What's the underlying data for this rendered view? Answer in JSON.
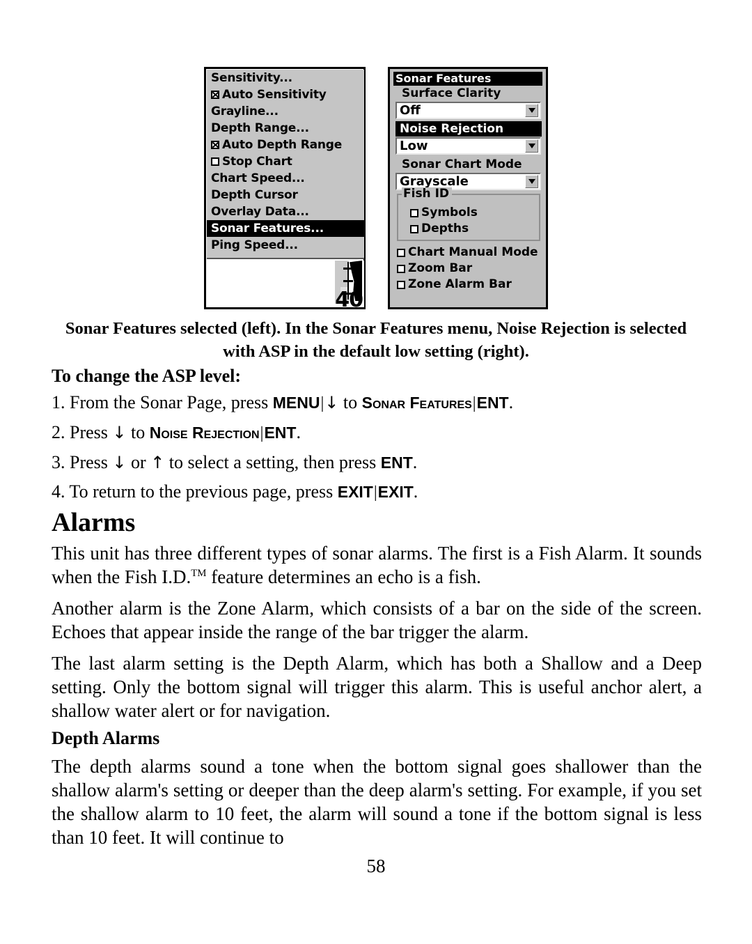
{
  "figure": {
    "left_panel": {
      "name": "sonar-main-menu",
      "menu_items": [
        {
          "label": "Sensitivity...",
          "checkbox": "none",
          "selected": false
        },
        {
          "label": "Auto Sensitivity",
          "checkbox": "checked",
          "selected": false
        },
        {
          "label": "Grayline...",
          "checkbox": "none",
          "selected": false
        },
        {
          "label": "Depth Range...",
          "checkbox": "none",
          "selected": false
        },
        {
          "label": "Auto Depth Range",
          "checkbox": "checked",
          "selected": false
        },
        {
          "label": "Stop Chart",
          "checkbox": "empty",
          "selected": false
        },
        {
          "label": "Chart Speed...",
          "checkbox": "none",
          "selected": false
        },
        {
          "label": "Depth Cursor",
          "checkbox": "none",
          "selected": false
        },
        {
          "label": "Overlay Data...",
          "checkbox": "none",
          "selected": false
        },
        {
          "label": "Sonar Features...",
          "checkbox": "none",
          "selected": true
        },
        {
          "label": "Ping Speed...",
          "checkbox": "none",
          "selected": false
        }
      ],
      "sonar_depth_reading": "40"
    },
    "right_panel": {
      "title": "Sonar Features",
      "fields": [
        {
          "label": "Surface Clarity",
          "value": "Off",
          "label_selected": false
        },
        {
          "label": "Noise Rejection",
          "value": "Low",
          "label_selected": true
        },
        {
          "label": "Sonar Chart Mode",
          "value": "Grayscale",
          "label_selected": false
        }
      ],
      "fish_id_group": {
        "legend": "Fish ID",
        "options": [
          {
            "label": "Symbols",
            "checked": false
          },
          {
            "label": "Depths",
            "checked": false
          }
        ]
      },
      "toggles": [
        {
          "label": "Chart Manual Mode",
          "checked": false
        },
        {
          "label": "Zoom Bar",
          "checked": false
        },
        {
          "label": "Zone Alarm Bar",
          "checked": false
        }
      ]
    }
  },
  "caption": "Sonar Features selected (left). In the Sonar Features menu, Noise Rejection is selected with ASP in the default low setting (right).",
  "headings": {
    "asp": "To change the ASP level:",
    "alarms": "Alarms",
    "depth_alarms": "Depth Alarms"
  },
  "steps": {
    "step1": {
      "number": "1.",
      "text_a": "From the Sonar Page, press",
      "key1": "MENU",
      "arrow1": "↓",
      "text_b": "to",
      "target": "Sonar Features",
      "key2": "ENT",
      "period": "."
    },
    "step2": {
      "number": "2.",
      "text_a": "Press",
      "arrow1": "↓",
      "text_b": "to",
      "target": "Noise Rejection",
      "key2": "ENT",
      "period": "."
    },
    "step3": {
      "number": "3.",
      "text_a": "Press",
      "arrow1": "↓",
      "text_b": "or",
      "arrow2": "↑",
      "text_c": "to select a setting, then press",
      "key1": "ENT",
      "period": "."
    },
    "step4": {
      "number": "4.",
      "text_a": "To return to the previous page, press",
      "key1": "EXIT",
      "key2": "EXIT",
      "period": "."
    }
  },
  "paragraphs": {
    "p1_a": "This unit has three different types of sonar alarms. The first is a Fish Alarm. It sounds when the Fish I.D.",
    "p1_tm": "TM",
    "p1_b": " feature determines an echo is a fish.",
    "p2": "Another alarm is the Zone Alarm, which consists of a bar on the side of the screen. Echoes that appear inside the range of the bar trigger the alarm.",
    "p3": "The last alarm setting is the Depth Alarm, which has both a Shallow and a Deep setting. Only the bottom signal will trigger this alarm. This is useful anchor alert, a shallow water alert or for navigation.",
    "p4": "The depth alarms sound a tone when the bottom signal goes shallower than the shallow alarm's setting or deeper than the deep alarm's setting. For example, if you set the shallow alarm to 10 feet, the alarm will sound a tone if the bottom signal is less than 10 feet. It will continue to"
  },
  "page_number": "58"
}
